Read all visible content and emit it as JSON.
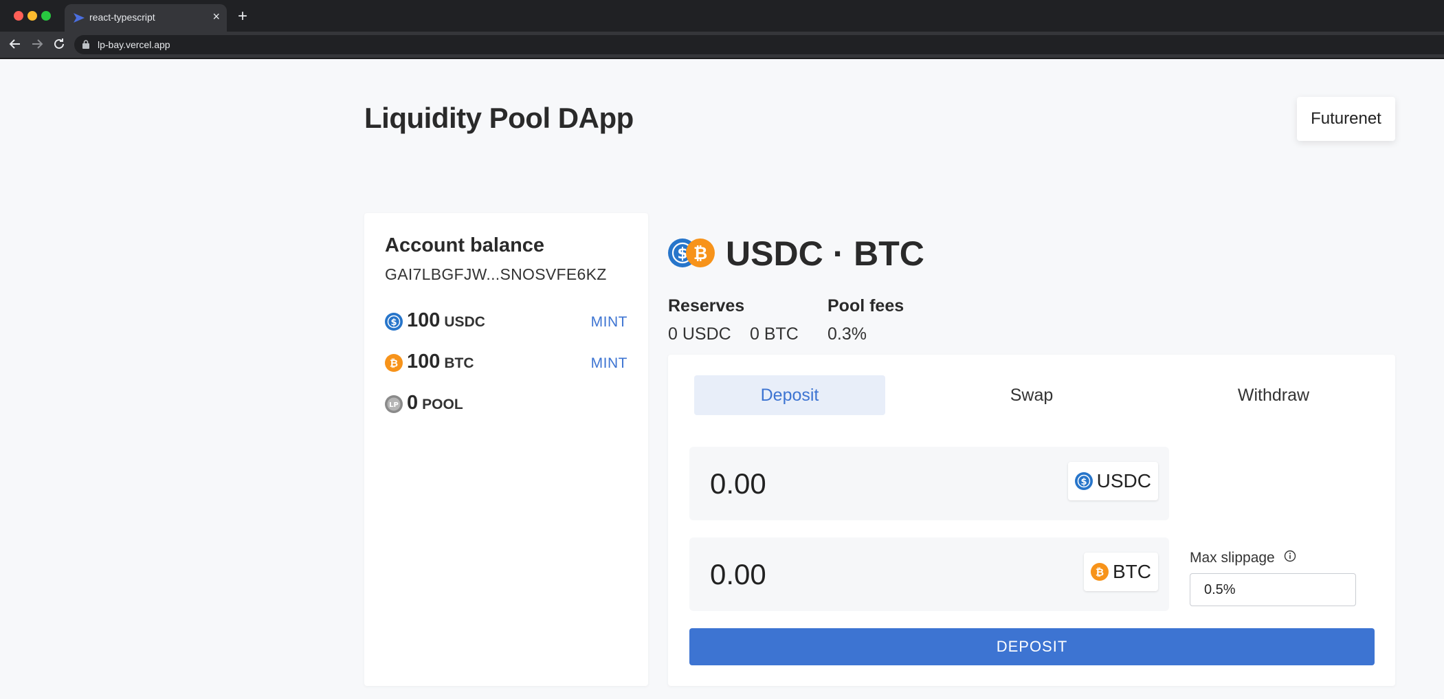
{
  "browser": {
    "tab_title": "react-typescript",
    "url": "lp-bay.vercel.app",
    "new_tab": "+",
    "close_tab": "×"
  },
  "app": {
    "title": "Liquidity Pool DApp",
    "network": "Futurenet"
  },
  "account": {
    "heading": "Account balance",
    "address": "GAI7LBGFJW...SNOSVFE6KZ",
    "balances": [
      {
        "amount": "100",
        "symbol": "USDC",
        "action": "MINT",
        "icon": "usdc-icon"
      },
      {
        "amount": "100",
        "symbol": "BTC",
        "action": "MINT",
        "icon": "btc-icon"
      },
      {
        "amount": "0",
        "symbol": "POOL",
        "icon": "lp-icon"
      }
    ]
  },
  "pool": {
    "pair": "USDC · BTC",
    "reserves_label": "Reserves",
    "reserve_a": "0 USDC",
    "reserve_b": "0 BTC",
    "fees_label": "Pool fees",
    "fees_value": "0.3%"
  },
  "tabs": [
    "Deposit",
    "Swap",
    "Withdraw"
  ],
  "active_tab": "Deposit",
  "deposit": {
    "amount_a": "0.00",
    "token_a": "USDC",
    "amount_b": "0.00",
    "token_b": "BTC",
    "slippage_label": "Max slippage",
    "slippage_value": "0.5%",
    "button": "DEPOSIT"
  },
  "colors": {
    "accent": "#3d74d2",
    "usdc": "#2775ca",
    "btc": "#f7931a",
    "lp": "#8a8a8a",
    "page_bg": "#f7f8fa"
  }
}
